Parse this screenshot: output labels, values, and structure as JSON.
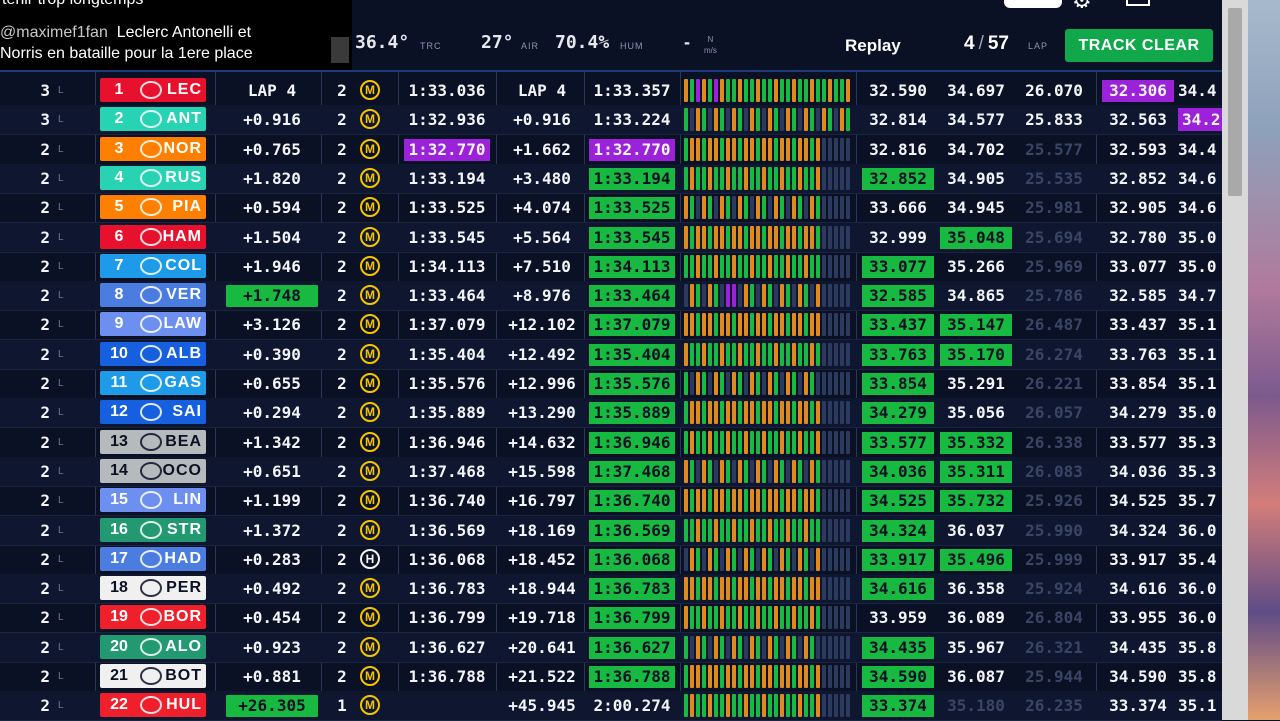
{
  "chat": {
    "line0": "tenir trop longtemps",
    "user": "@maximef1fan",
    "message1": "Leclerc Antonelli et",
    "message2": "Norris en bataille pour la 1ere place"
  },
  "weather": {
    "track_temp": "36.4°",
    "track_tag": "TRC",
    "air_temp": "27°",
    "air_tag": "AIR",
    "humidity": "70.4%",
    "hum_tag": "HUM",
    "wind": "-",
    "wind_unit_top": "N",
    "wind_unit_bottom": "m/s"
  },
  "header": {
    "replay_label": "Replay",
    "lap_current": "4",
    "lap_total": "57",
    "lap_tag": "LAP",
    "track_status": "TRACK CLEAR"
  },
  "colors": {
    "ferrari": "#e8112d",
    "mercedes": "#27d3b2",
    "mclaren": "#ff8000",
    "alpine": "#1e9be8",
    "redbull": "#4b7de0",
    "racingbulls": "#6d8ff0",
    "williams": "#1660e0",
    "haas": "#b6babd",
    "astonmartin": "#229971",
    "sauber": "#ef1f2b",
    "white_team": "#f0f0f0",
    "green": "#18b941",
    "purple": "#9b22d9",
    "soft_tyre": "#f5c400",
    "hard_tyre": "#f2f2f2"
  },
  "rows": [
    {
      "stops": "3",
      "tag": "L",
      "pos": "1",
      "code": "LEC",
      "team": "ferrari",
      "gap": "LAP 4",
      "gap_hl": false,
      "tyre_age": "2",
      "tyre": "M",
      "last": "1:33.036",
      "last_hl": "",
      "int": "LAP 4",
      "best": "1:33.357",
      "best_hl": "",
      "s1": "32.590",
      "s1_hl": "",
      "s2": "34.697",
      "s2_hl": "",
      "s3": "26.070",
      "s3_dim": false,
      "s4": "32.306",
      "s4_hl": "purple",
      "s5": "34.4",
      "s5_hl": ""
    },
    {
      "stops": "3",
      "tag": "L",
      "pos": "2",
      "code": "ANT",
      "team": "mercedes",
      "gap": "+0.916",
      "gap_hl": false,
      "tyre_age": "2",
      "tyre": "M",
      "last": "1:32.936",
      "last_hl": "",
      "int": "+0.916",
      "best": "1:33.224",
      "best_hl": "",
      "s1": "32.814",
      "s1_hl": "",
      "s2": "34.577",
      "s2_hl": "",
      "s3": "25.833",
      "s3_dim": false,
      "s4": "32.563",
      "s4_hl": "",
      "s5": "34.2",
      "s5_hl": "purple"
    },
    {
      "stops": "2",
      "tag": "L",
      "pos": "3",
      "code": "NOR",
      "team": "mclaren",
      "gap": "+0.765",
      "gap_hl": false,
      "tyre_age": "2",
      "tyre": "M",
      "last": "1:32.770",
      "last_hl": "purple",
      "int": "+1.662",
      "best": "1:32.770",
      "best_hl": "purple",
      "s1": "32.816",
      "s1_hl": "",
      "s2": "34.702",
      "s2_hl": "",
      "s3": "25.577",
      "s3_dim": true,
      "s4": "32.593",
      "s4_hl": "",
      "s5": "34.4",
      "s5_hl": ""
    },
    {
      "stops": "2",
      "tag": "L",
      "pos": "4",
      "code": "RUS",
      "team": "mercedes",
      "gap": "+1.820",
      "gap_hl": false,
      "tyre_age": "2",
      "tyre": "M",
      "last": "1:33.194",
      "last_hl": "",
      "int": "+3.480",
      "best": "1:33.194",
      "best_hl": "green",
      "s1": "32.852",
      "s1_hl": "green",
      "s2": "34.905",
      "s2_hl": "",
      "s3": "25.535",
      "s3_dim": true,
      "s4": "32.852",
      "s4_hl": "",
      "s5": "34.6",
      "s5_hl": ""
    },
    {
      "stops": "2",
      "tag": "L",
      "pos": "5",
      "code": "PIA",
      "team": "mclaren",
      "gap": "+0.594",
      "gap_hl": false,
      "tyre_age": "2",
      "tyre": "M",
      "last": "1:33.525",
      "last_hl": "",
      "int": "+4.074",
      "best": "1:33.525",
      "best_hl": "green",
      "s1": "33.666",
      "s1_hl": "",
      "s2": "34.945",
      "s2_hl": "",
      "s3": "25.981",
      "s3_dim": true,
      "s4": "32.905",
      "s4_hl": "",
      "s5": "34.6",
      "s5_hl": ""
    },
    {
      "stops": "2",
      "tag": "L",
      "pos": "6",
      "code": "HAM",
      "team": "ferrari",
      "gap": "+1.504",
      "gap_hl": false,
      "tyre_age": "2",
      "tyre": "M",
      "last": "1:33.545",
      "last_hl": "",
      "int": "+5.564",
      "best": "1:33.545",
      "best_hl": "green",
      "s1": "32.999",
      "s1_hl": "",
      "s2": "35.048",
      "s2_hl": "green",
      "s3": "25.694",
      "s3_dim": true,
      "s4": "32.780",
      "s4_hl": "",
      "s5": "35.0",
      "s5_hl": ""
    },
    {
      "stops": "2",
      "tag": "L",
      "pos": "7",
      "code": "COL",
      "team": "alpine",
      "gap": "+1.946",
      "gap_hl": false,
      "tyre_age": "2",
      "tyre": "M",
      "last": "1:34.113",
      "last_hl": "",
      "int": "+7.510",
      "best": "1:34.113",
      "best_hl": "green",
      "s1": "33.077",
      "s1_hl": "green",
      "s2": "35.266",
      "s2_hl": "",
      "s3": "25.969",
      "s3_dim": true,
      "s4": "33.077",
      "s4_hl": "",
      "s5": "35.0",
      "s5_hl": ""
    },
    {
      "stops": "2",
      "tag": "L",
      "pos": "8",
      "code": "VER",
      "team": "redbull",
      "gap": "+1.748",
      "gap_hl": true,
      "tyre_age": "2",
      "tyre": "M",
      "last": "1:33.464",
      "last_hl": "",
      "int": "+8.976",
      "best": "1:33.464",
      "best_hl": "green",
      "s1": "32.585",
      "s1_hl": "green",
      "s2": "34.865",
      "s2_hl": "",
      "s3": "25.786",
      "s3_dim": true,
      "s4": "32.585",
      "s4_hl": "",
      "s5": "34.7",
      "s5_hl": ""
    },
    {
      "stops": "2",
      "tag": "L",
      "pos": "9",
      "code": "LAW",
      "team": "racingbulls",
      "gap": "+3.126",
      "gap_hl": false,
      "tyre_age": "2",
      "tyre": "M",
      "last": "1:37.079",
      "last_hl": "",
      "int": "+12.102",
      "best": "1:37.079",
      "best_hl": "green",
      "s1": "33.437",
      "s1_hl": "green",
      "s2": "35.147",
      "s2_hl": "green",
      "s3": "26.487",
      "s3_dim": true,
      "s4": "33.437",
      "s4_hl": "",
      "s5": "35.1",
      "s5_hl": ""
    },
    {
      "stops": "2",
      "tag": "L",
      "pos": "10",
      "code": "ALB",
      "team": "williams",
      "gap": "+0.390",
      "gap_hl": false,
      "tyre_age": "2",
      "tyre": "M",
      "last": "1:35.404",
      "last_hl": "",
      "int": "+12.492",
      "best": "1:35.404",
      "best_hl": "green",
      "s1": "33.763",
      "s1_hl": "green",
      "s2": "35.170",
      "s2_hl": "green",
      "s3": "26.274",
      "s3_dim": true,
      "s4": "33.763",
      "s4_hl": "",
      "s5": "35.1",
      "s5_hl": ""
    },
    {
      "stops": "2",
      "tag": "L",
      "pos": "11",
      "code": "GAS",
      "team": "alpine",
      "gap": "+0.655",
      "gap_hl": false,
      "tyre_age": "2",
      "tyre": "M",
      "last": "1:35.576",
      "last_hl": "",
      "int": "+12.996",
      "best": "1:35.576",
      "best_hl": "green",
      "s1": "33.854",
      "s1_hl": "green",
      "s2": "35.291",
      "s2_hl": "",
      "s3": "26.221",
      "s3_dim": true,
      "s4": "33.854",
      "s4_hl": "",
      "s5": "35.1",
      "s5_hl": ""
    },
    {
      "stops": "2",
      "tag": "L",
      "pos": "12",
      "code": "SAI",
      "team": "williams",
      "gap": "+0.294",
      "gap_hl": false,
      "tyre_age": "2",
      "tyre": "M",
      "last": "1:35.889",
      "last_hl": "",
      "int": "+13.290",
      "best": "1:35.889",
      "best_hl": "green",
      "s1": "34.279",
      "s1_hl": "green",
      "s2": "35.056",
      "s2_hl": "",
      "s3": "26.057",
      "s3_dim": true,
      "s4": "34.279",
      "s4_hl": "",
      "s5": "35.0",
      "s5_hl": ""
    },
    {
      "stops": "2",
      "tag": "L",
      "pos": "13",
      "code": "BEA",
      "team": "haas",
      "gap": "+1.342",
      "gap_hl": false,
      "tyre_age": "2",
      "tyre": "M",
      "last": "1:36.946",
      "last_hl": "",
      "int": "+14.632",
      "best": "1:36.946",
      "best_hl": "green",
      "s1": "33.577",
      "s1_hl": "green",
      "s2": "35.332",
      "s2_hl": "green",
      "s3": "26.338",
      "s3_dim": true,
      "s4": "33.577",
      "s4_hl": "",
      "s5": "35.3",
      "s5_hl": ""
    },
    {
      "stops": "2",
      "tag": "L",
      "pos": "14",
      "code": "OCO",
      "team": "haas",
      "gap": "+0.651",
      "gap_hl": false,
      "tyre_age": "2",
      "tyre": "M",
      "last": "1:37.468",
      "last_hl": "",
      "int": "+15.598",
      "best": "1:37.468",
      "best_hl": "green",
      "s1": "34.036",
      "s1_hl": "green",
      "s2": "35.311",
      "s2_hl": "green",
      "s3": "26.083",
      "s3_dim": true,
      "s4": "34.036",
      "s4_hl": "",
      "s5": "35.3",
      "s5_hl": ""
    },
    {
      "stops": "2",
      "tag": "L",
      "pos": "15",
      "code": "LIN",
      "team": "racingbulls",
      "gap": "+1.199",
      "gap_hl": false,
      "tyre_age": "2",
      "tyre": "M",
      "last": "1:36.740",
      "last_hl": "",
      "int": "+16.797",
      "best": "1:36.740",
      "best_hl": "green",
      "s1": "34.525",
      "s1_hl": "green",
      "s2": "35.732",
      "s2_hl": "green",
      "s3": "25.926",
      "s3_dim": true,
      "s4": "34.525",
      "s4_hl": "",
      "s5": "35.7",
      "s5_hl": ""
    },
    {
      "stops": "2",
      "tag": "L",
      "pos": "16",
      "code": "STR",
      "team": "astonmartin",
      "gap": "+1.372",
      "gap_hl": false,
      "tyre_age": "2",
      "tyre": "M",
      "last": "1:36.569",
      "last_hl": "",
      "int": "+18.169",
      "best": "1:36.569",
      "best_hl": "green",
      "s1": "34.324",
      "s1_hl": "green",
      "s2": "36.037",
      "s2_hl": "",
      "s3": "25.990",
      "s3_dim": true,
      "s4": "34.324",
      "s4_hl": "",
      "s5": "36.0",
      "s5_hl": ""
    },
    {
      "stops": "2",
      "tag": "L",
      "pos": "17",
      "code": "HAD",
      "team": "redbull",
      "gap": "+0.283",
      "gap_hl": false,
      "tyre_age": "2",
      "tyre": "H",
      "last": "1:36.068",
      "last_hl": "",
      "int": "+18.452",
      "best": "1:36.068",
      "best_hl": "green",
      "s1": "33.917",
      "s1_hl": "green",
      "s2": "35.496",
      "s2_hl": "green",
      "s3": "25.999",
      "s3_dim": true,
      "s4": "33.917",
      "s4_hl": "",
      "s5": "35.4",
      "s5_hl": ""
    },
    {
      "stops": "2",
      "tag": "L",
      "pos": "18",
      "code": "PER",
      "team": "white_team",
      "gap": "+0.492",
      "gap_hl": false,
      "tyre_age": "2",
      "tyre": "M",
      "last": "1:36.783",
      "last_hl": "",
      "int": "+18.944",
      "best": "1:36.783",
      "best_hl": "green",
      "s1": "34.616",
      "s1_hl": "green",
      "s2": "36.358",
      "s2_hl": "",
      "s3": "25.924",
      "s3_dim": true,
      "s4": "34.616",
      "s4_hl": "",
      "s5": "36.0",
      "s5_hl": ""
    },
    {
      "stops": "2",
      "tag": "L",
      "pos": "19",
      "code": "BOR",
      "team": "sauber",
      "gap": "+0.454",
      "gap_hl": false,
      "tyre_age": "2",
      "tyre": "M",
      "last": "1:36.799",
      "last_hl": "",
      "int": "+19.718",
      "best": "1:36.799",
      "best_hl": "green",
      "s1": "33.959",
      "s1_hl": "",
      "s2": "36.089",
      "s2_hl": "",
      "s3": "26.804",
      "s3_dim": true,
      "s4": "33.955",
      "s4_hl": "",
      "s5": "36.0",
      "s5_hl": ""
    },
    {
      "stops": "2",
      "tag": "L",
      "pos": "20",
      "code": "ALO",
      "team": "astonmartin",
      "gap": "+0.923",
      "gap_hl": false,
      "tyre_age": "2",
      "tyre": "M",
      "last": "1:36.627",
      "last_hl": "",
      "int": "+20.641",
      "best": "1:36.627",
      "best_hl": "green",
      "s1": "34.435",
      "s1_hl": "green",
      "s2": "35.967",
      "s2_hl": "",
      "s3": "26.321",
      "s3_dim": true,
      "s4": "34.435",
      "s4_hl": "",
      "s5": "35.8",
      "s5_hl": ""
    },
    {
      "stops": "2",
      "tag": "L",
      "pos": "21",
      "code": "BOT",
      "team": "white_team",
      "gap": "+0.881",
      "gap_hl": false,
      "tyre_age": "2",
      "tyre": "M",
      "last": "1:36.788",
      "last_hl": "",
      "int": "+21.522",
      "best": "1:36.788",
      "best_hl": "green",
      "s1": "34.590",
      "s1_hl": "green",
      "s2": "36.087",
      "s2_hl": "",
      "s3": "25.944",
      "s3_dim": true,
      "s4": "34.590",
      "s4_hl": "",
      "s5": "35.8",
      "s5_hl": ""
    },
    {
      "stops": "2",
      "tag": "L",
      "pos": "22",
      "code": "HUL",
      "team": "sauber",
      "gap": "+26.305",
      "gap_hl": true,
      "tyre_age": "1",
      "tyre": "M",
      "last": "",
      "last_hl": "",
      "int": "+45.945",
      "best": "2:00.274",
      "best_hl": "",
      "s1": "33.374",
      "s1_hl": "green",
      "s2": "35.180",
      "s2_hl": "dim",
      "s3": "26.235",
      "s3_dim": true,
      "s4": "33.374",
      "s4_hl": "",
      "s5": "35.1",
      "s5_hl": ""
    }
  ]
}
